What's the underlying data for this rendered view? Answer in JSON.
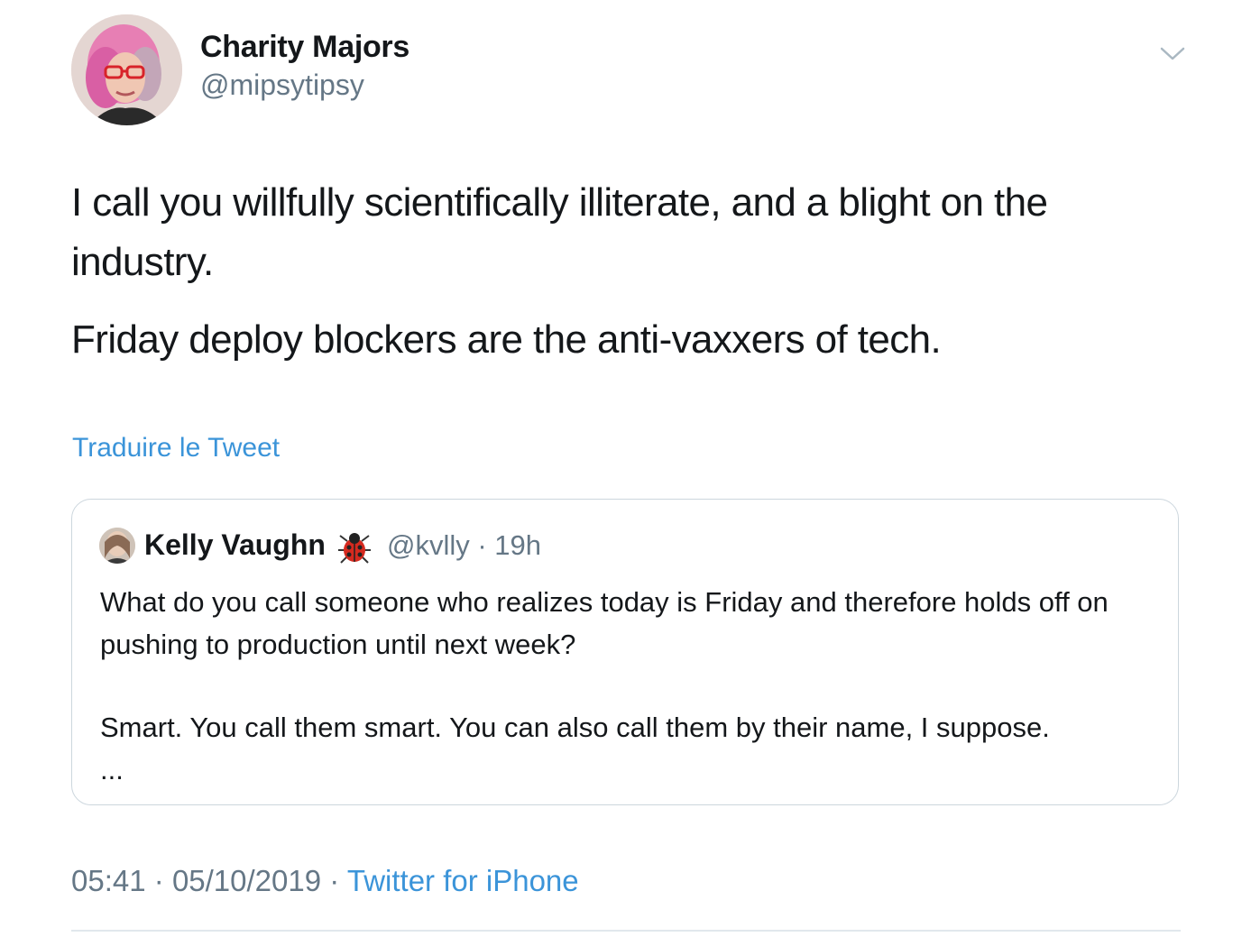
{
  "tweet": {
    "author_name": "Charity Majors",
    "author_handle": "@mipsytipsy",
    "avatar_icon": "avatar-photo",
    "menu_icon": "chevron-down-icon",
    "paragraphs": [
      "I call you willfully scientifically illiterate, and a blight on the industry.",
      "Friday deploy blockers are the anti-vaxxers of tech."
    ],
    "translate_label": "Traduire le Tweet",
    "time": "05:41",
    "date": "05/10/2019",
    "separator": "·",
    "source": "Twitter for iPhone"
  },
  "quoted": {
    "author_name": "Kelly Vaughn",
    "emoji_icon": "ladybug-icon",
    "handle_time": "@kvlly · 19h",
    "paragraphs": [
      "What do you call someone who realizes today is Friday and therefore holds off on pushing to production until next week?",
      "Smart. You call them smart. You can also call them by their name, I suppose.",
      "..."
    ]
  },
  "colors": {
    "text": "#14171a",
    "secondary": "#657786",
    "link": "#3b94d9",
    "border": "#ccd6dd"
  }
}
